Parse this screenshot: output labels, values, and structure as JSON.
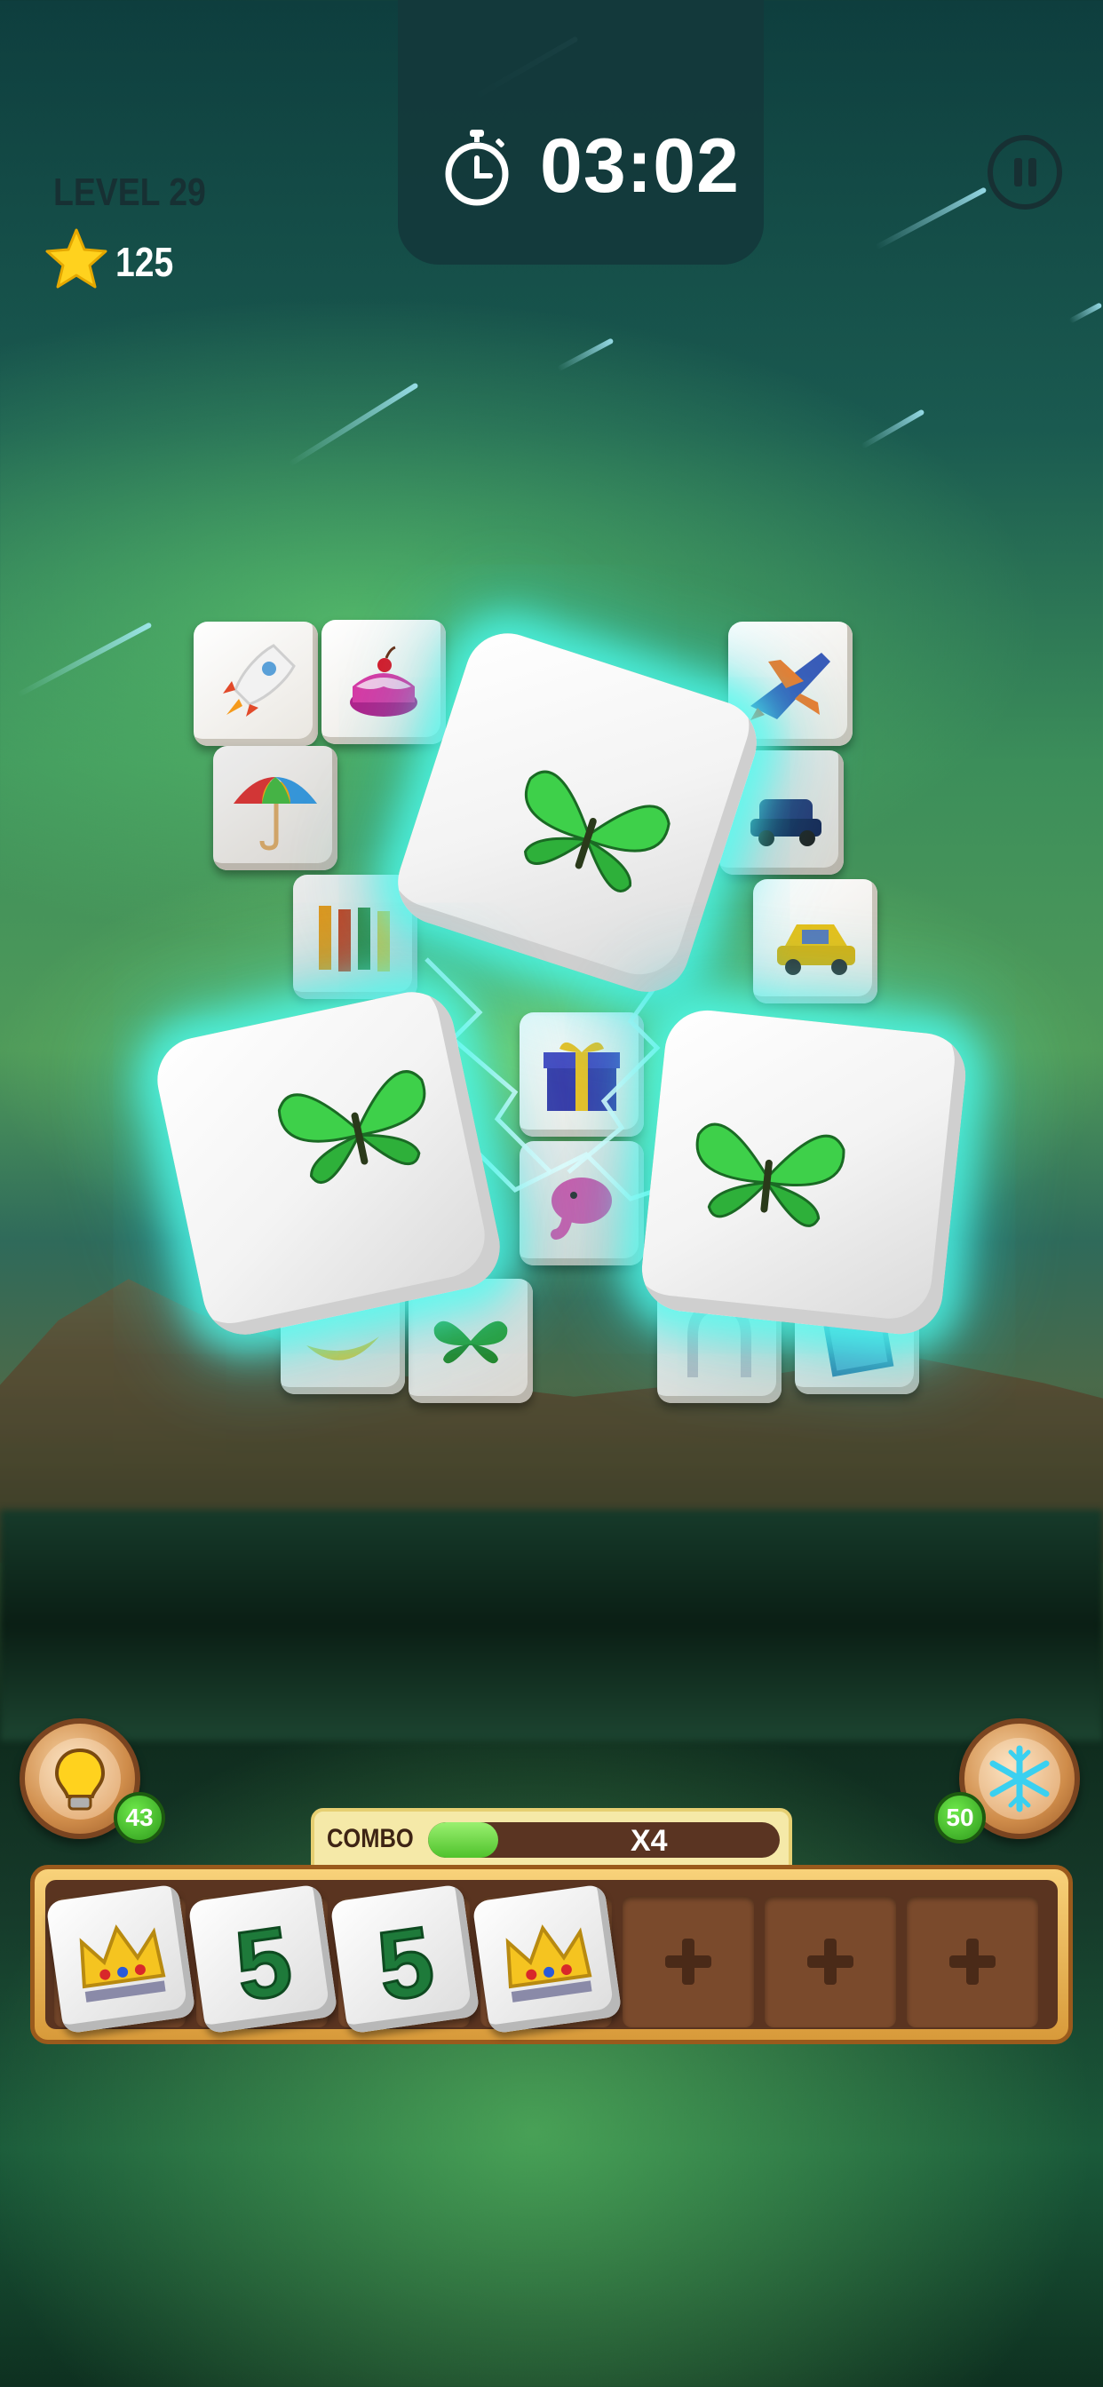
{
  "hud": {
    "timer": "03:02",
    "level": "LEVEL 29",
    "stars": "125"
  },
  "icons": {
    "timer": "stopwatch-icon",
    "stars": "star-icon",
    "pause": "pause-icon",
    "hint": "lightbulb-icon",
    "freeze": "snowflake-icon",
    "empty_slot": "plus-icon"
  },
  "board": {
    "matched_cubes": [
      "butterfly",
      "butterfly",
      "butterfly"
    ],
    "tiles": [
      "rocket",
      "cake",
      "umbrella",
      "gift",
      "airplane",
      "car",
      "taxi",
      "crayons",
      "elephant",
      "butterfly",
      "banana",
      "horseshoe",
      "book"
    ]
  },
  "boosters": {
    "hint_count": "43",
    "freeze_count": "50"
  },
  "combo": {
    "label": "COMBO",
    "multiplier": "X4",
    "progress": 0.2
  },
  "tray": {
    "slots": [
      {
        "item": "crown",
        "label": ""
      },
      {
        "item": "number-five",
        "label": "5"
      },
      {
        "item": "number-five",
        "label": "5"
      },
      {
        "item": "crown",
        "label": ""
      },
      {
        "item": "empty"
      },
      {
        "item": "empty"
      },
      {
        "item": "empty"
      }
    ]
  }
}
